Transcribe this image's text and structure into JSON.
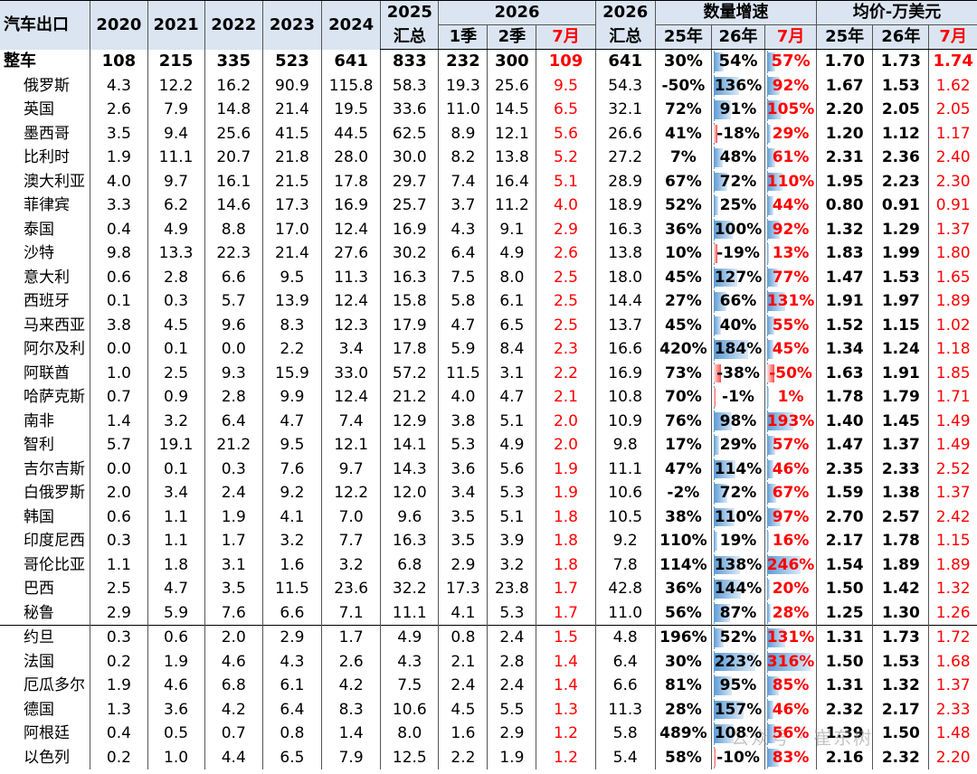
{
  "header": {
    "title": "汽车出口",
    "years": [
      "2020",
      "2021",
      "2022",
      "2023",
      "2024"
    ],
    "y2025_top": "2025",
    "y2025_bottom": "汇总",
    "y2026_group": "2026",
    "q1": "1季",
    "q2": "2季",
    "m7": "7月",
    "y2026_top": "2026",
    "y2026_bottom": "汇总",
    "growth_group": "数量增速",
    "g25": "25年",
    "g26": "26年",
    "g7": "7月",
    "price_group": "均价-万美元",
    "p25": "25年",
    "p26": "26年",
    "p7": "7月"
  },
  "total": {
    "name": "整车",
    "vals": [
      "108",
      "215",
      "335",
      "523",
      "641",
      "833",
      "232",
      "300",
      "109",
      "641"
    ],
    "g25": "30%",
    "g26": "54%",
    "g7": "57%",
    "p": [
      "1.70",
      "1.73",
      "1.74"
    ]
  },
  "rows": [
    {
      "name": "俄罗斯",
      "vals": [
        "4.3",
        "12.2",
        "16.2",
        "90.9",
        "115.8",
        "58.3",
        "19.3",
        "25.6",
        "9.5",
        "54.3"
      ],
      "g25": "-50%",
      "g26": "136%",
      "g7": "92%",
      "p": [
        "1.67",
        "1.53",
        "1.62"
      ]
    },
    {
      "name": "英国",
      "vals": [
        "2.6",
        "7.9",
        "14.8",
        "21.4",
        "19.5",
        "33.6",
        "11.0",
        "14.5",
        "6.5",
        "32.1"
      ],
      "g25": "72%",
      "g26": "91%",
      "g7": "105%",
      "p": [
        "2.20",
        "2.05",
        "2.05"
      ]
    },
    {
      "name": "墨西哥",
      "vals": [
        "3.5",
        "9.4",
        "25.6",
        "41.5",
        "44.5",
        "62.5",
        "8.9",
        "12.1",
        "5.6",
        "26.6"
      ],
      "g25": "41%",
      "g26": "-18%",
      "g7": "29%",
      "p": [
        "1.20",
        "1.12",
        "1.17"
      ]
    },
    {
      "name": "比利时",
      "vals": [
        "1.9",
        "11.1",
        "20.7",
        "21.8",
        "28.0",
        "30.0",
        "8.2",
        "13.8",
        "5.2",
        "27.2"
      ],
      "g25": "7%",
      "g26": "48%",
      "g7": "61%",
      "p": [
        "2.31",
        "2.36",
        "2.40"
      ]
    },
    {
      "name": "澳大利亚",
      "vals": [
        "4.0",
        "9.7",
        "16.1",
        "21.5",
        "17.8",
        "29.7",
        "7.4",
        "16.4",
        "5.1",
        "28.9"
      ],
      "g25": "67%",
      "g26": "72%",
      "g7": "110%",
      "p": [
        "1.95",
        "2.23",
        "2.30"
      ]
    },
    {
      "name": "菲律宾",
      "vals": [
        "3.3",
        "6.2",
        "14.6",
        "17.3",
        "16.9",
        "25.7",
        "3.7",
        "11.2",
        "4.0",
        "18.9"
      ],
      "g25": "52%",
      "g26": "25%",
      "g7": "44%",
      "p": [
        "0.80",
        "0.91",
        "0.91"
      ]
    },
    {
      "name": "泰国",
      "vals": [
        "0.4",
        "4.9",
        "8.8",
        "17.0",
        "12.4",
        "16.9",
        "4.3",
        "9.1",
        "2.9",
        "16.3"
      ],
      "g25": "36%",
      "g26": "100%",
      "g7": "92%",
      "p": [
        "1.32",
        "1.29",
        "1.37"
      ]
    },
    {
      "name": "沙特",
      "vals": [
        "9.8",
        "13.3",
        "22.3",
        "21.4",
        "27.6",
        "30.2",
        "6.4",
        "4.9",
        "2.6",
        "13.8"
      ],
      "g25": "10%",
      "g26": "-19%",
      "g7": "13%",
      "p": [
        "1.83",
        "1.99",
        "1.80"
      ]
    },
    {
      "name": "意大利",
      "vals": [
        "0.6",
        "2.8",
        "6.6",
        "9.5",
        "11.3",
        "16.3",
        "7.5",
        "8.0",
        "2.5",
        "18.0"
      ],
      "g25": "45%",
      "g26": "127%",
      "g7": "77%",
      "p": [
        "1.47",
        "1.53",
        "1.65"
      ]
    },
    {
      "name": "西班牙",
      "vals": [
        "0.1",
        "0.3",
        "5.7",
        "13.9",
        "12.4",
        "15.8",
        "5.8",
        "6.1",
        "2.5",
        "14.4"
      ],
      "g25": "27%",
      "g26": "66%",
      "g7": "131%",
      "p": [
        "1.91",
        "1.97",
        "1.89"
      ]
    },
    {
      "name": "马来西亚",
      "vals": [
        "3.8",
        "4.5",
        "9.6",
        "8.3",
        "12.3",
        "17.9",
        "4.7",
        "6.5",
        "2.5",
        "13.7"
      ],
      "g25": "45%",
      "g26": "40%",
      "g7": "55%",
      "p": [
        "1.52",
        "1.15",
        "1.02"
      ]
    },
    {
      "name": "阿尔及利",
      "vals": [
        "0.0",
        "0.1",
        "0.0",
        "2.2",
        "3.4",
        "17.8",
        "5.9",
        "8.4",
        "2.3",
        "16.6"
      ],
      "g25": "420%",
      "g26": "184%",
      "g7": "45%",
      "p": [
        "1.34",
        "1.24",
        "1.18"
      ]
    },
    {
      "name": "阿联酋",
      "vals": [
        "1.0",
        "2.5",
        "9.3",
        "15.9",
        "33.0",
        "57.2",
        "11.5",
        "3.1",
        "2.2",
        "16.9"
      ],
      "g25": "73%",
      "g26": "-38%",
      "g7": "-50%",
      "p": [
        "1.63",
        "1.91",
        "1.85"
      ]
    },
    {
      "name": "哈萨克斯",
      "vals": [
        "0.7",
        "0.9",
        "2.8",
        "9.9",
        "12.4",
        "21.2",
        "4.0",
        "4.7",
        "2.1",
        "10.8"
      ],
      "g25": "70%",
      "g26": "-1%",
      "g7": "1%",
      "p": [
        "1.78",
        "1.79",
        "1.71"
      ]
    },
    {
      "name": "南非",
      "vals": [
        "1.4",
        "3.2",
        "6.4",
        "4.7",
        "7.4",
        "12.9",
        "3.8",
        "5.1",
        "2.0",
        "10.9"
      ],
      "g25": "76%",
      "g26": "98%",
      "g7": "193%",
      "p": [
        "1.40",
        "1.45",
        "1.49"
      ]
    },
    {
      "name": "智利",
      "vals": [
        "5.7",
        "19.1",
        "21.2",
        "9.5",
        "12.1",
        "14.1",
        "5.3",
        "4.9",
        "2.0",
        "9.8"
      ],
      "g25": "17%",
      "g26": "29%",
      "g7": "57%",
      "p": [
        "1.47",
        "1.37",
        "1.49"
      ]
    },
    {
      "name": "吉尔吉斯",
      "vals": [
        "0.0",
        "0.1",
        "0.3",
        "7.6",
        "9.7",
        "14.3",
        "3.6",
        "5.6",
        "1.9",
        "11.1"
      ],
      "g25": "47%",
      "g26": "114%",
      "g7": "46%",
      "p": [
        "2.35",
        "2.33",
        "2.52"
      ]
    },
    {
      "name": "白俄罗斯",
      "vals": [
        "2.0",
        "3.4",
        "2.4",
        "9.2",
        "12.2",
        "12.0",
        "3.4",
        "5.3",
        "1.9",
        "10.6"
      ],
      "g25": "-2%",
      "g26": "72%",
      "g7": "67%",
      "p": [
        "1.59",
        "1.38",
        "1.37"
      ]
    },
    {
      "name": "韩国",
      "vals": [
        "0.6",
        "1.1",
        "1.9",
        "4.1",
        "7.0",
        "9.6",
        "3.5",
        "5.1",
        "1.8",
        "10.5"
      ],
      "g25": "38%",
      "g26": "110%",
      "g7": "97%",
      "p": [
        "2.70",
        "2.57",
        "2.42"
      ]
    },
    {
      "name": "印度尼西",
      "vals": [
        "0.3",
        "1.1",
        "1.7",
        "3.2",
        "7.7",
        "16.3",
        "3.5",
        "3.9",
        "1.8",
        "9.2"
      ],
      "g25": "110%",
      "g26": "19%",
      "g7": "16%",
      "p": [
        "2.17",
        "1.78",
        "1.15"
      ]
    },
    {
      "name": "哥伦比亚",
      "vals": [
        "1.1",
        "1.8",
        "3.1",
        "1.6",
        "3.2",
        "6.8",
        "2.9",
        "3.2",
        "1.8",
        "7.8"
      ],
      "g25": "114%",
      "g26": "138%",
      "g7": "246%",
      "p": [
        "1.54",
        "1.89",
        "1.89"
      ]
    },
    {
      "name": "巴西",
      "vals": [
        "2.5",
        "4.7",
        "3.5",
        "11.5",
        "23.6",
        "32.2",
        "17.3",
        "23.8",
        "1.7",
        "42.8"
      ],
      "g25": "36%",
      "g26": "144%",
      "g7": "20%",
      "p": [
        "1.50",
        "1.42",
        "1.32"
      ]
    },
    {
      "name": "秘鲁",
      "vals": [
        "2.9",
        "5.9",
        "7.6",
        "6.6",
        "7.1",
        "11.1",
        "4.1",
        "5.3",
        "1.7",
        "11.0"
      ],
      "g25": "56%",
      "g26": "87%",
      "g7": "28%",
      "p": [
        "1.25",
        "1.30",
        "1.26"
      ]
    },
    {
      "name": "约旦",
      "vals": [
        "0.3",
        "0.6",
        "2.0",
        "2.9",
        "1.7",
        "4.9",
        "0.8",
        "2.4",
        "1.5",
        "4.8"
      ],
      "g25": "196%",
      "g26": "52%",
      "g7": "131%",
      "p": [
        "1.31",
        "1.73",
        "1.72"
      ]
    },
    {
      "name": "法国",
      "vals": [
        "0.2",
        "1.9",
        "4.6",
        "4.3",
        "2.6",
        "4.3",
        "2.1",
        "2.8",
        "1.4",
        "6.4"
      ],
      "g25": "30%",
      "g26": "223%",
      "g7": "316%",
      "p": [
        "1.50",
        "1.53",
        "1.68"
      ]
    },
    {
      "name": "厄瓜多尔",
      "vals": [
        "1.9",
        "4.6",
        "6.8",
        "6.1",
        "4.2",
        "7.5",
        "2.4",
        "2.4",
        "1.4",
        "6.6"
      ],
      "g25": "81%",
      "g26": "95%",
      "g7": "85%",
      "p": [
        "1.31",
        "1.32",
        "1.37"
      ]
    },
    {
      "name": "德国",
      "vals": [
        "1.3",
        "3.6",
        "4.2",
        "6.4",
        "8.3",
        "10.6",
        "4.5",
        "5.5",
        "1.3",
        "11.3"
      ],
      "g25": "28%",
      "g26": "157%",
      "g7": "46%",
      "p": [
        "2.32",
        "2.17",
        "2.33"
      ]
    },
    {
      "name": "阿根廷",
      "vals": [
        "0.4",
        "0.5",
        "0.7",
        "0.8",
        "1.4",
        "8.0",
        "1.6",
        "2.9",
        "1.2",
        "5.8"
      ],
      "g25": "489%",
      "g26": "108%",
      "g7": "56%",
      "p": [
        "1.39",
        "1.50",
        "1.48"
      ]
    },
    {
      "name": "以色列",
      "vals": [
        "0.2",
        "1.0",
        "4.4",
        "6.5",
        "7.9",
        "12.5",
        "2.2",
        "1.9",
        "1.2",
        "5.4"
      ],
      "g25": "58%",
      "g26": "-10%",
      "g7": "83%",
      "p": [
        "2.16",
        "2.32",
        "2.20"
      ]
    }
  ],
  "watermark": "公众号 · 崔东树",
  "colors": {
    "header_bg": "#dbe5f1",
    "accent_red": "#ff0000",
    "bar_blue": "#5b9bd5",
    "bar_red": "#ff4d4d"
  }
}
